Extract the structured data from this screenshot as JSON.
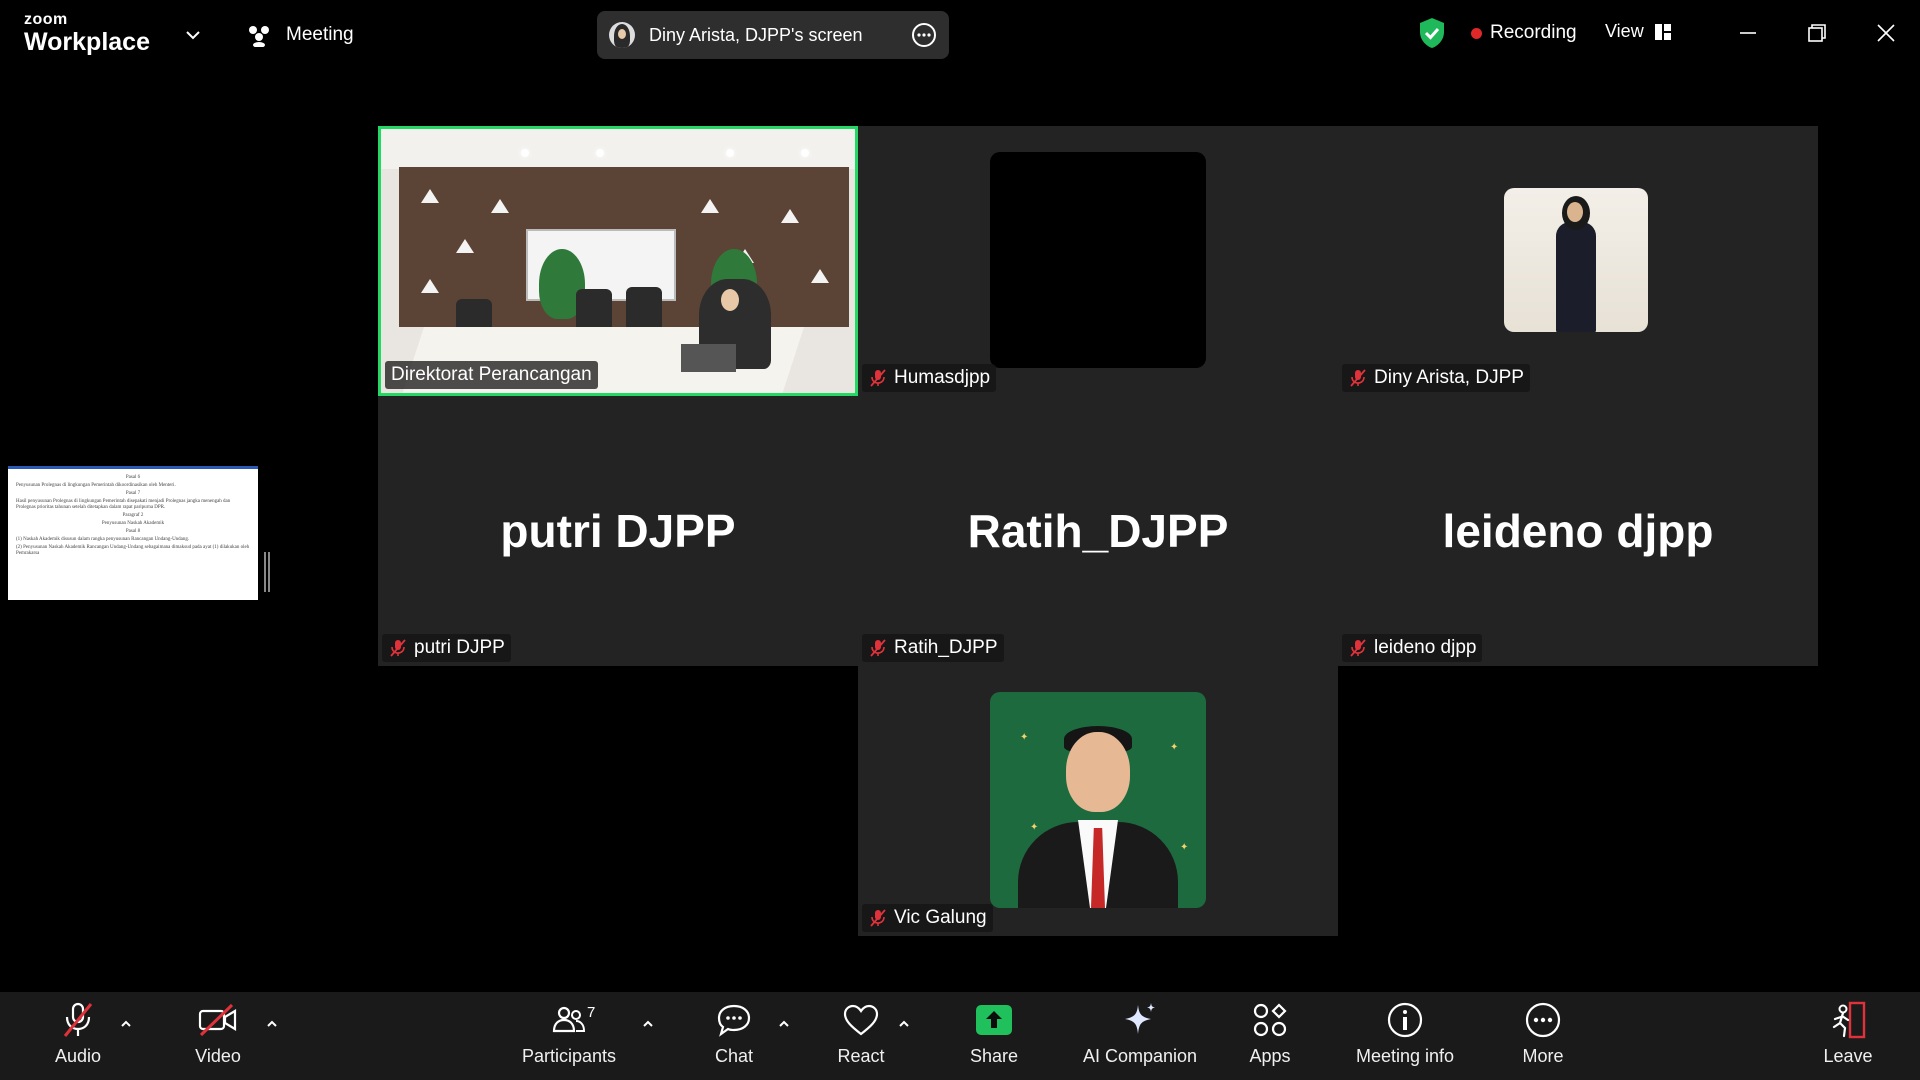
{
  "app": {
    "brand_small": "zoom",
    "brand_large": "Workplace",
    "meeting_label": "Meeting",
    "screen_share_label": "Diny Arista, DJPP's screen",
    "recording_label": "Recording",
    "view_label": "View"
  },
  "colors": {
    "active_speaker_border": "#23d963",
    "recording_dot": "#e02828",
    "mute_icon": "#e0323a",
    "share_button": "#20c05c"
  },
  "participants": [
    {
      "name": "Direktorat Perancangan",
      "display": "video",
      "muted": false,
      "active": true
    },
    {
      "name": "Humasdjpp",
      "display": "black-avatar",
      "muted": true
    },
    {
      "name": "Diny Arista, DJPP",
      "display": "photo",
      "muted": true
    },
    {
      "name": "putri DJPP",
      "display": "name",
      "big_name": "putri DJPP",
      "muted": true
    },
    {
      "name": "Ratih_DJPP",
      "display": "name",
      "big_name": "Ratih_DJPP",
      "muted": true
    },
    {
      "name": "leideno djpp",
      "display": "name",
      "big_name": "leideno djpp",
      "muted": true
    },
    {
      "name": "Vic Galung",
      "display": "photo",
      "muted": true
    }
  ],
  "shared_doc": {
    "lines": [
      "Pasal 6",
      "Penyusunan Prolegnas di lingkungan Pemerintah dikoordinasikan oleh Menteri.",
      "Pasal 7",
      "Hasil penyusunan Prolegnas di lingkungan Pemerintah disepakati menjadi Prolegnas jangka menengah dan Prolegnas prioritas tahunan setelah ditetapkan dalam rapat paripurna DPR.",
      "Paragraf 2",
      "Penyusunan Naskah Akademik",
      "Pasal 8",
      "(1) Naskah Akademik disusun dalam rangka penyusunan Rancangan Undang-Undang.",
      "(2) Penyusunan Naskah Akademik Rancangan Undang-Undang sebagaimana dimaksud pada ayat (1) dilakukan oleh Pemrakarsa"
    ]
  },
  "toolbar": {
    "audio": "Audio",
    "video": "Video",
    "participants": "Participants",
    "participants_count": "7",
    "chat": "Chat",
    "react": "React",
    "share": "Share",
    "ai_companion": "AI Companion",
    "apps": "Apps",
    "meeting_info": "Meeting info",
    "more": "More",
    "leave": "Leave"
  },
  "icons": {
    "shield": "shield-check-icon",
    "view": "view-grid-icon",
    "minimize": "minimize-icon",
    "restore": "restore-icon",
    "close": "close-icon",
    "mute": "mic-muted-icon"
  }
}
